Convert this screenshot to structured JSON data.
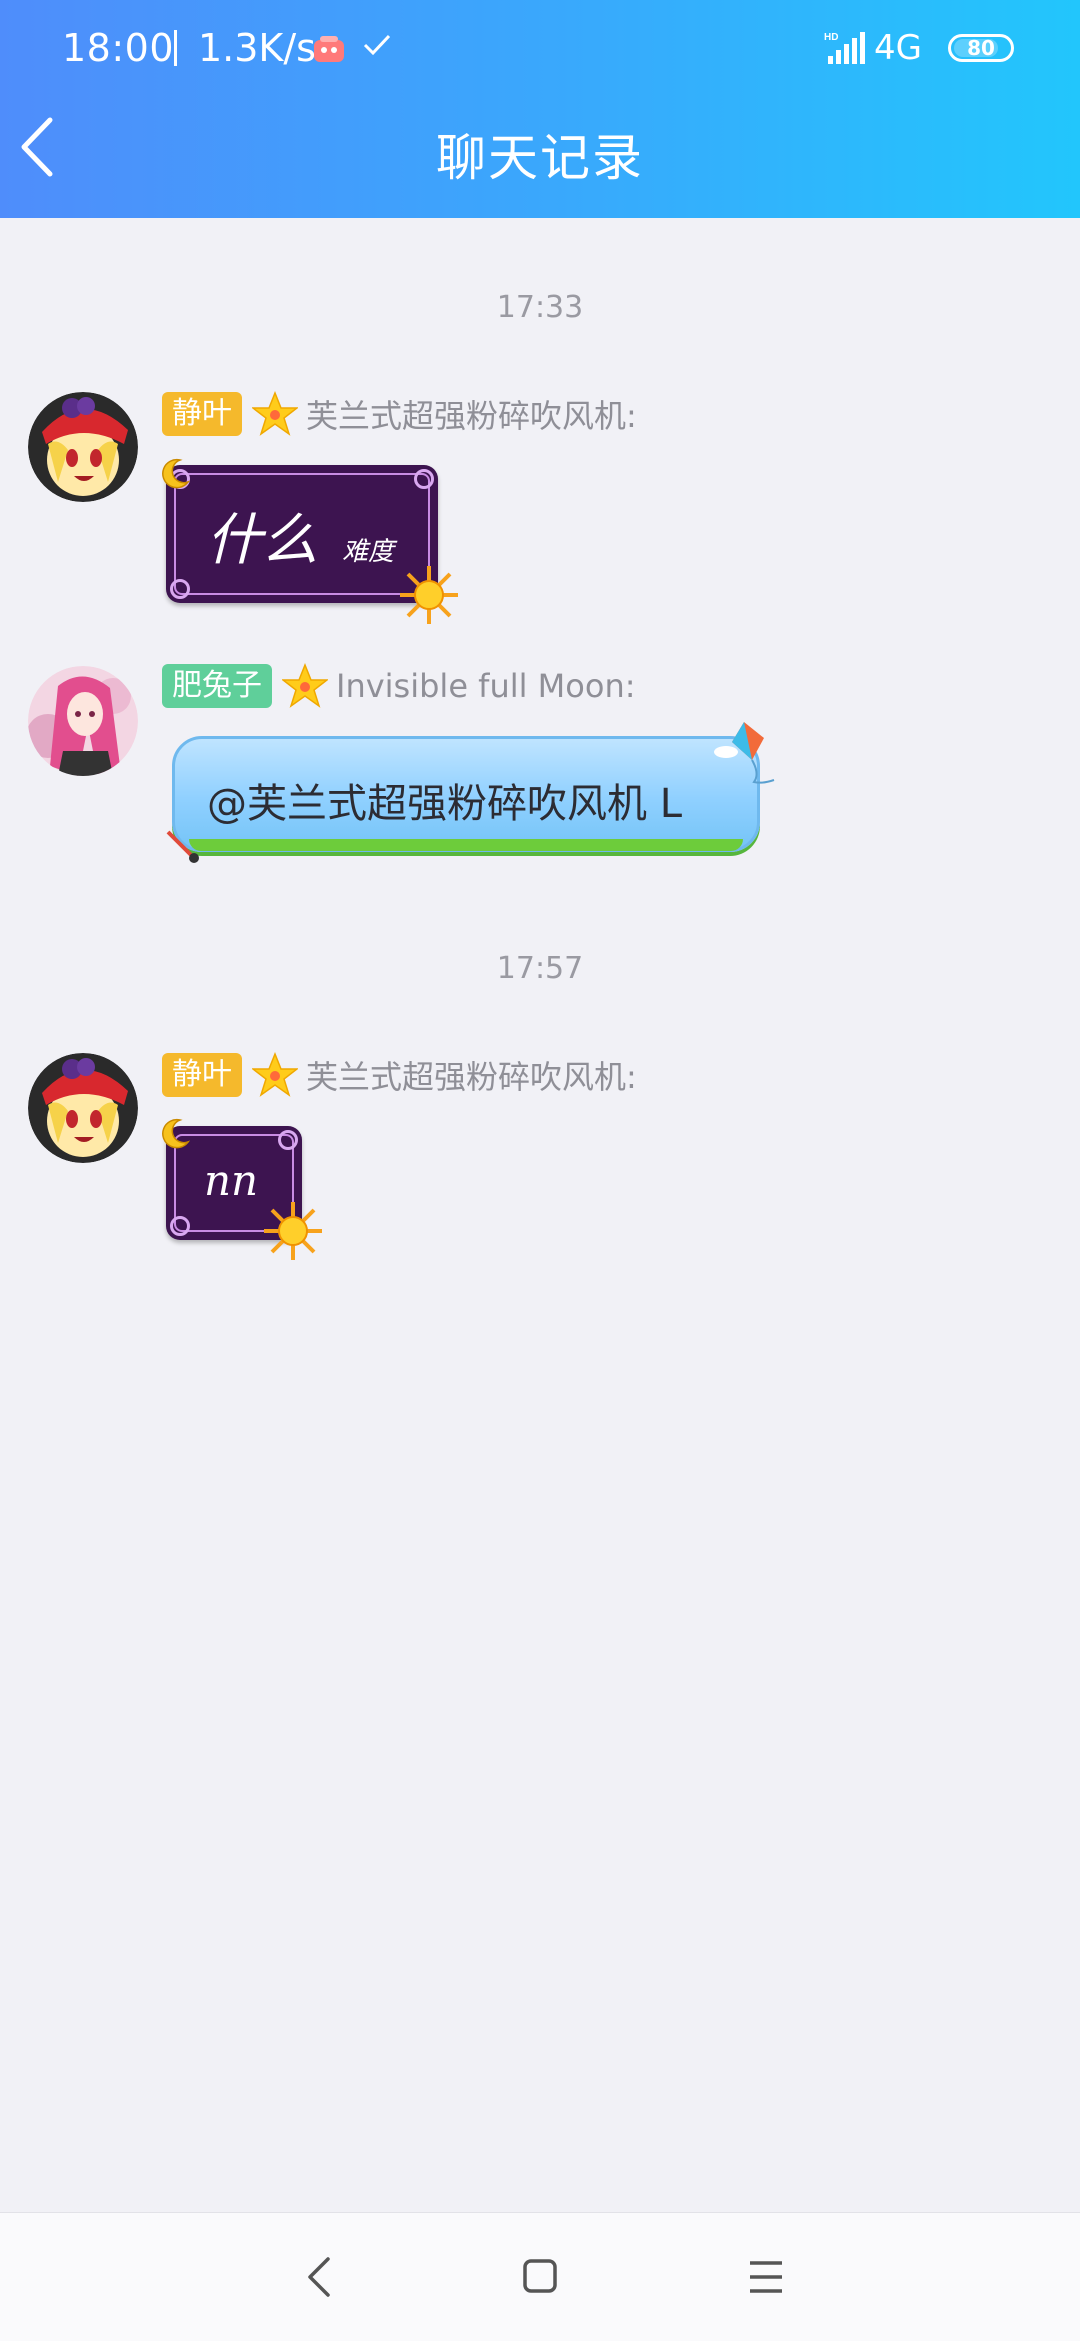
{
  "status_bar": {
    "time": "18:00",
    "net_speed": "1.3K/s",
    "network": "4G",
    "battery": "80"
  },
  "header": {
    "title": "聊天记录"
  },
  "messages": [
    {
      "time": "17:33",
      "tag": "静叶",
      "sender": "芙兰式超强粉碎吹风机:",
      "text_main": "什么",
      "text_sub": "难度"
    },
    {
      "tag": "肥兔子",
      "sender": "Invisible full Moon:",
      "text": "@芙兰式超强粉碎吹风机 L"
    },
    {
      "time": "17:57",
      "tag": "静叶",
      "sender": "芙兰式超强粉碎吹风机:",
      "text": "nn"
    }
  ],
  "nav": {
    "back_icon": "chevron-left-icon",
    "home_icon": "square-icon",
    "menu_icon": "hamburger-icon"
  },
  "colors": {
    "header_start": "#4f8dfb",
    "header_end": "#22c6fc",
    "background": "#f1f1f6",
    "tag_gold": "#f5b92c",
    "tag_green": "#5fcf9a",
    "bubble_purple": "#3d1450"
  }
}
